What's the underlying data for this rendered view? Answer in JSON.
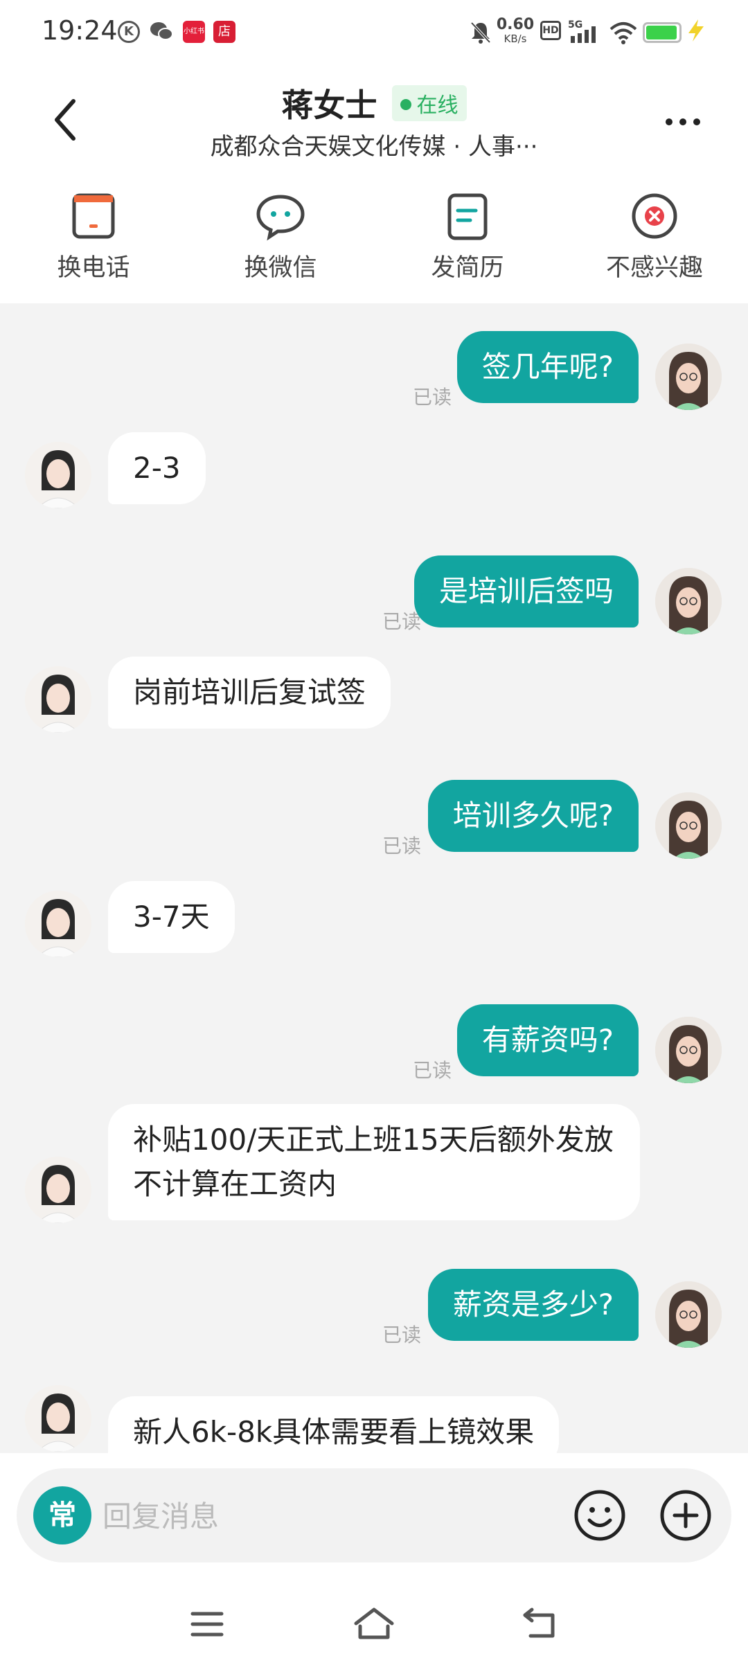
{
  "status_bar": {
    "time": "19:24",
    "speed_value": "0.60",
    "speed_unit": "KB/s",
    "hd": "HD",
    "network": "5G",
    "badge_1": "小红书",
    "badge_2": "店"
  },
  "header": {
    "contact_name": "蒋女士",
    "online_status": "在线",
    "subtitle": "成都众合天娱文化传媒 · 人事···"
  },
  "actions": [
    {
      "label": "换电话",
      "icon": "phone-card-icon"
    },
    {
      "label": "换微信",
      "icon": "chat-bubble-icon"
    },
    {
      "label": "发简历",
      "icon": "resume-icon"
    },
    {
      "label": "不感兴趣",
      "icon": "close-circle-icon"
    }
  ],
  "messages": [
    {
      "from": "me",
      "text": "签几年呢?",
      "read": "已读"
    },
    {
      "from": "them",
      "text": "2-3"
    },
    {
      "from": "me",
      "text": "是培训后签吗",
      "read": "已读"
    },
    {
      "from": "them",
      "text": "岗前培训后复试签"
    },
    {
      "from": "me",
      "text": "培训多久呢?",
      "read": "已读"
    },
    {
      "from": "them",
      "text": "3-7天"
    },
    {
      "from": "me",
      "text": "有薪资吗?",
      "read": "已读"
    },
    {
      "from": "them",
      "text": "补贴100/天正式上班15天后额外发放不计算在工资内"
    },
    {
      "from": "me",
      "text": "薪资是多少?",
      "read": "已读"
    },
    {
      "from": "them",
      "text": "新人6k-8k具体需要看上镜效果"
    }
  ],
  "input": {
    "quick_label": "常",
    "placeholder": "回复消息"
  },
  "colors": {
    "accent": "#12a5a0",
    "online": "#29b061",
    "danger": "#e8424a",
    "phone_icon": "#f06a3c"
  }
}
